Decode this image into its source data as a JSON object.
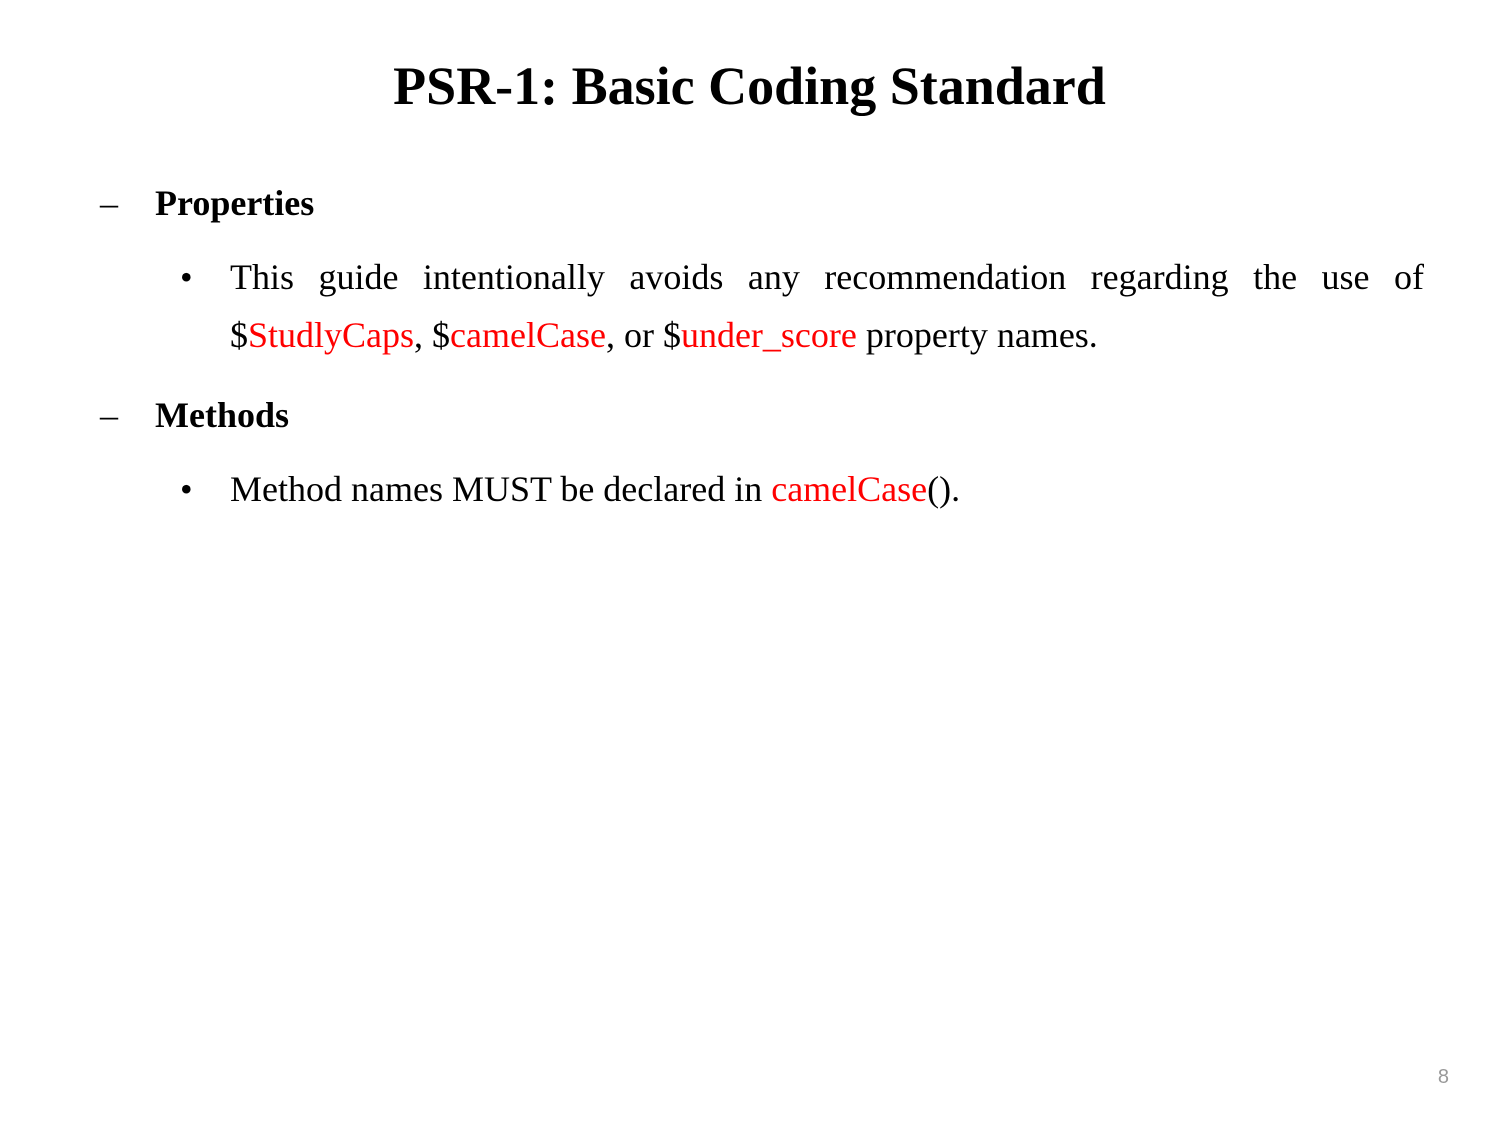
{
  "title": "PSR-1: Basic Coding Standard",
  "sections": [
    {
      "heading": "Properties",
      "bullets": [
        {
          "justify": true,
          "parts": [
            {
              "text": "This guide intentionally avoids any recommendation regarding the use of $",
              "red": false
            },
            {
              "text": "StudlyCaps",
              "red": true
            },
            {
              "text": ", $",
              "red": false
            },
            {
              "text": "camelCase",
              "red": true
            },
            {
              "text": ", or $",
              "red": false
            },
            {
              "text": "under_score",
              "red": true
            },
            {
              "text": " property names.",
              "red": false
            }
          ]
        }
      ]
    },
    {
      "heading": "Methods",
      "bullets": [
        {
          "justify": false,
          "parts": [
            {
              "text": "Method names MUST be declared in ",
              "red": false
            },
            {
              "text": "camelCase",
              "red": true
            },
            {
              "text": "().",
              "red": false
            }
          ]
        }
      ]
    }
  ],
  "pageNumber": "8"
}
